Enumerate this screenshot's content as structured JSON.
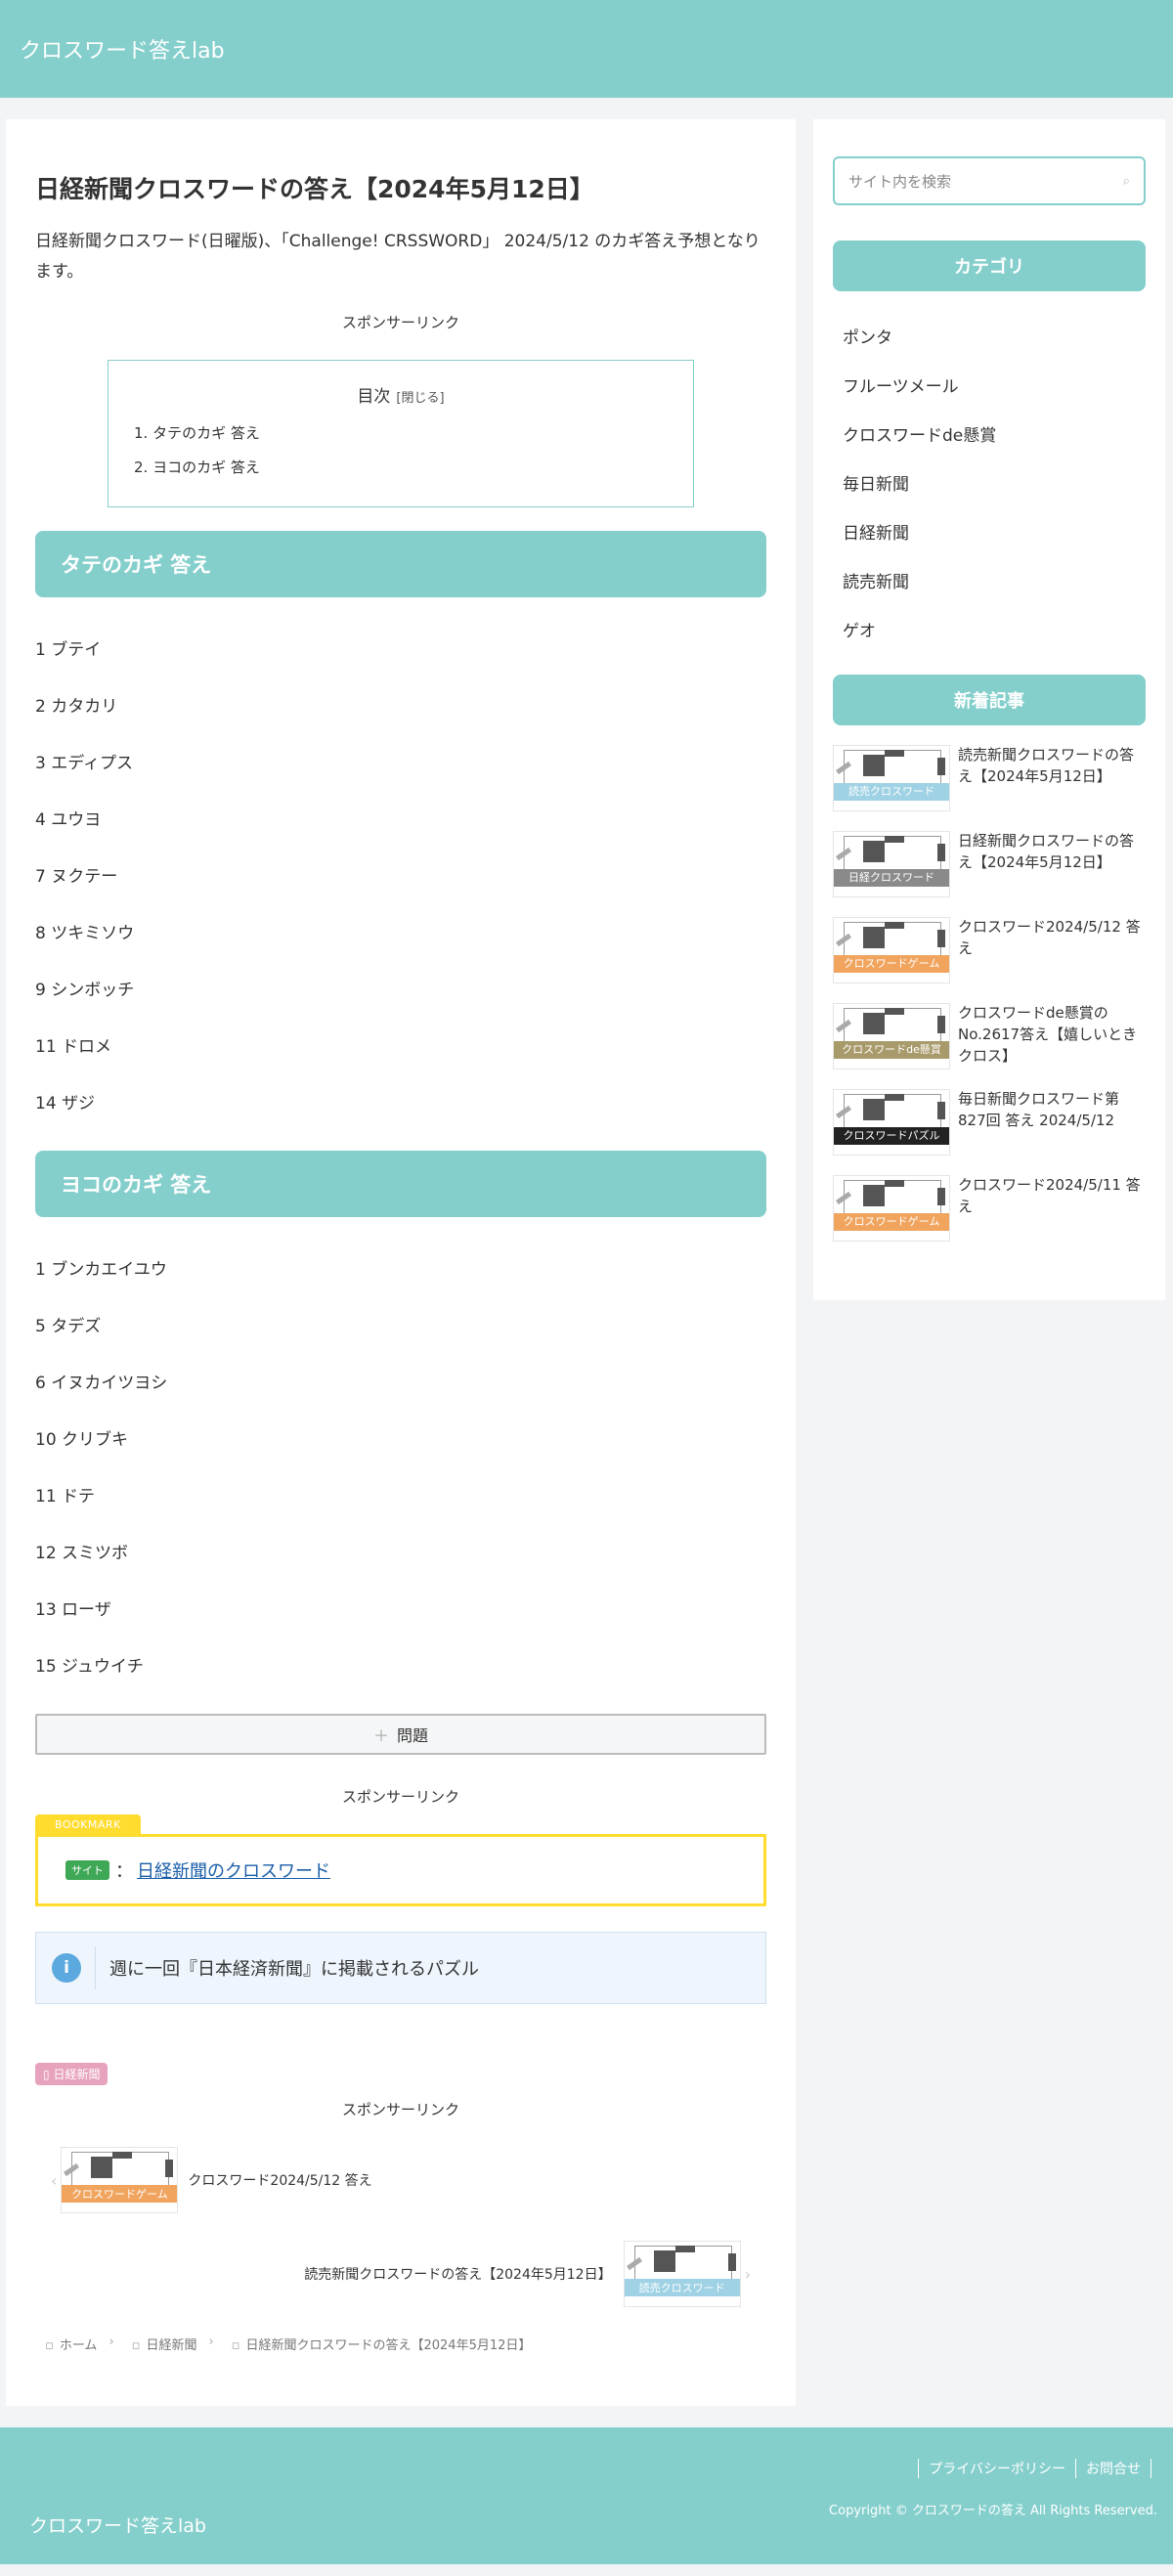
{
  "header": {
    "site_title": "クロスワード答えlab"
  },
  "article": {
    "title": "日経新聞クロスワードの答え【2024年5月12日】",
    "intro": "日経新聞クロスワード(日曜版)、「Challenge! CRSSWORD」 2024/5/12 のカギ答え予想となります。",
    "sponsor_label": "スポンサーリンク",
    "toc": {
      "title": "目次",
      "toggle": "[閉じる]",
      "items": [
        "1. タテのカギ 答え",
        "2. ヨコのカギ 答え"
      ]
    },
    "tate": {
      "heading": "タテのカギ 答え",
      "answers": [
        "1 ブテイ",
        "2 カタカリ",
        "3 エディプス",
        "4 ユウヨ",
        "7 ヌクテー",
        "8 ツキミソウ",
        "9 シンボッチ",
        "11 ドロメ",
        "14 ザジ"
      ]
    },
    "yoko": {
      "heading": "ヨコのカギ 答え",
      "answers": [
        "1 ブンカエイユウ",
        "5 タデズ",
        "6 イヌカイツヨシ",
        "10 クリブキ",
        "11 ドテ",
        "12 スミツボ",
        "13 ローザ",
        "15 ジュウイチ"
      ]
    },
    "toggle_button": "問題",
    "bookmark": {
      "label": "BOOKMARK",
      "badge": "サイト",
      "separator": "：",
      "link_text": "日経新聞のクロスワード"
    },
    "info": {
      "icon": "i",
      "text": "週に一回『日本経済新聞』に掲載されるパズル"
    },
    "category_tag": "日経新聞",
    "related": {
      "prev": {
        "title": "クロスワード2024/5/12 答え",
        "thumb_label": "クロスワードゲーム"
      },
      "next": {
        "title": "読売新聞クロスワードの答え【2024年5月12日】",
        "thumb_label": "読売クロスワード"
      }
    },
    "breadcrumb": [
      "ホーム",
      "日経新聞",
      "日経新聞クロスワードの答え【2024年5月12日】"
    ]
  },
  "sidebar": {
    "search_placeholder": "サイト内を検索",
    "category_title": "カテゴリ",
    "categories": [
      "ポンタ",
      "フルーツメール",
      "クロスワードde懸賞",
      "毎日新聞",
      "日経新聞",
      "読売新聞",
      "ゲオ"
    ],
    "recent_title": "新着記事",
    "recent": [
      {
        "title": "読売新聞クロスワードの答え【2024年5月12日】",
        "thumb_label": "読売クロスワード"
      },
      {
        "title": "日経新聞クロスワードの答え【2024年5月12日】",
        "thumb_label": "日経クロスワード"
      },
      {
        "title": "クロスワード2024/5/12 答え",
        "thumb_label": "クロスワードゲーム"
      },
      {
        "title": "クロスワードde懸賞のNo.2617答え【嬉しいときクロス】",
        "thumb_label": "クロスワードde懸賞"
      },
      {
        "title": "毎日新聞クロスワード第827回 答え 2024/5/12",
        "thumb_label": "クロスワードパズル"
      },
      {
        "title": "クロスワード2024/5/11 答え",
        "thumb_label": "クロスワードゲーム"
      }
    ]
  },
  "footer": {
    "links": [
      "プライバシーポリシー",
      "お問合せ"
    ],
    "copyright": "Copyright © クロスワードの答え All Rights Reserved.",
    "site_title": "クロスワード答えlab"
  },
  "colors": {
    "accent": "#84cfcc",
    "thumb_yomiuri": "#9fd2e4",
    "thumb_nikkei": "#8a8a8a",
    "thumb_game": "#f0a45e",
    "thumb_kensho": "#a89a6a",
    "thumb_puzzle": "#222222"
  }
}
